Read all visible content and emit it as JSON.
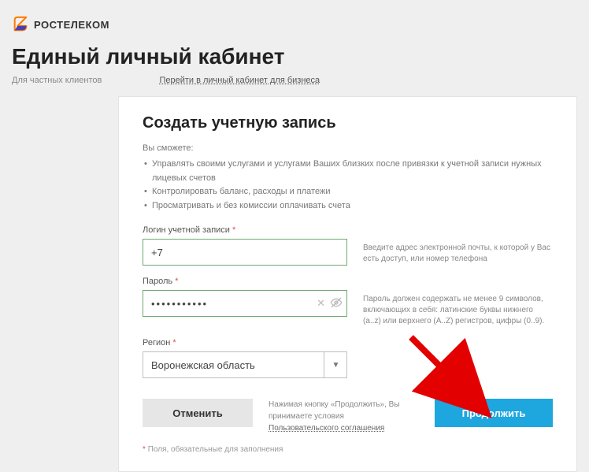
{
  "brand": {
    "name": "РОСТЕЛЕКОМ"
  },
  "page": {
    "title": "Единый личный кабинет",
    "audience": "Для частных клиентов",
    "biz_link": "Перейти в личный кабинет для бизнеса"
  },
  "card": {
    "title": "Создать учетную запись",
    "subtitle": "Вы сможете:",
    "bullets": [
      "Управлять своими услугами и услугами Ваших близких после привязки к учетной записи нужных лицевых счетов",
      "Контролировать баланс, расходы и платежи",
      "Просматривать и без комиссии оплачивать счета"
    ]
  },
  "form": {
    "login": {
      "label": "Логин учетной записи",
      "value": "+7",
      "hint": "Введите адрес электронной почты, к которой у Вас есть доступ, или номер телефона"
    },
    "password": {
      "label": "Пароль",
      "value": "•••••••••••",
      "hint": "Пароль должен содержать не менее 9 символов, включающих в себя: латинские буквы нижнего (a..z) или верхнего (A..Z) регистров, цифры (0..9)."
    },
    "region": {
      "label": "Регион",
      "value": "Воронежская область"
    }
  },
  "actions": {
    "cancel": "Отменить",
    "continue": "Продолжить",
    "terms_prefix": "Нажимая кнопку «Продолжить», Вы принимаете условия",
    "terms_link": "Пользовательского соглашения"
  },
  "footnote": "Поля, обязательные для заполнения"
}
